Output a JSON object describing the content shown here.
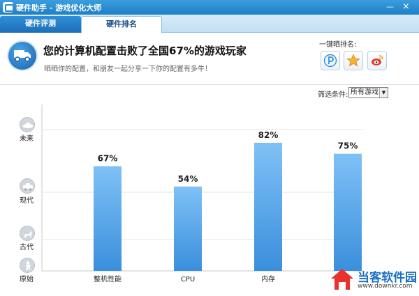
{
  "window": {
    "title": "硬件助手 - 游戏优化大师",
    "minimize": "—",
    "close": "×"
  },
  "tabs": [
    {
      "label": "硬件评测"
    },
    {
      "label": "硬件排名"
    }
  ],
  "header": {
    "headline": "您的计算机配置击败了全国67%的游戏玩家",
    "subline": "晒晒你的配置，和朋友一起分享一下你的配置有多牛！",
    "share_label": "一键晒排名:"
  },
  "filter": {
    "label": "筛选条件:",
    "selected": "所有游戏"
  },
  "levels": [
    {
      "label": "未来",
      "icon": "ufo-icon"
    },
    {
      "label": "现代",
      "icon": "car-icon"
    },
    {
      "label": "古代",
      "icon": "horse-icon"
    },
    {
      "label": "原始",
      "icon": "caveman-icon"
    }
  ],
  "chart_data": {
    "type": "bar",
    "categories": [
      "整机性能",
      "CPU",
      "内存",
      ""
    ],
    "values": [
      67,
      54,
      82,
      75
    ],
    "value_labels": [
      "67%",
      "54%",
      "82%",
      "75%"
    ],
    "ylim": [
      0,
      100
    ],
    "grid": true,
    "bar_color_top": "#7fc1f6",
    "bar_color_bottom": "#3a8fdc"
  },
  "watermark": {
    "text": "当客软件园",
    "url": "www.downkr.com"
  },
  "colors": {
    "titlebar": "#1f7fc8",
    "accent": "#2f8fd8"
  }
}
